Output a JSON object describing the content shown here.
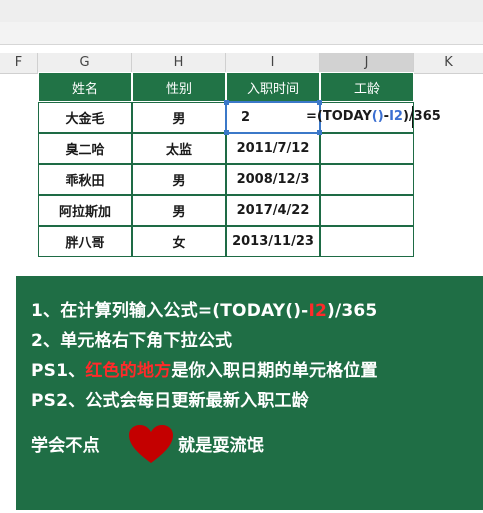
{
  "columns": [
    "F",
    "G",
    "H",
    "I",
    "J",
    "K"
  ],
  "table": {
    "headers": [
      "姓名",
      "性别",
      "入职时间",
      "工龄"
    ],
    "rows": [
      {
        "name": "大金毛",
        "gender": "男",
        "date": "2",
        "tenure": ""
      },
      {
        "name": "臭二哈",
        "gender": "太监",
        "date": "2011/7/12",
        "tenure": ""
      },
      {
        "name": "乖秋田",
        "gender": "男",
        "date": "2008/12/3",
        "tenure": ""
      },
      {
        "name": "阿拉斯加",
        "gender": "男",
        "date": "2017/4/22",
        "tenure": ""
      },
      {
        "name": "胖八哥",
        "gender": "女",
        "date": "2013/11/23",
        "tenure": ""
      }
    ]
  },
  "formula": {
    "prefix": "=(TODAY",
    "parens": "()",
    "minus": "-",
    "ref": "I2",
    "suffix": ")/365"
  },
  "tips": {
    "line1_prefix": "1、在计算列输入公式=(TODAY()-",
    "line1_ref": "I2",
    "line1_suffix": ")/365",
    "line2": "2、单元格右下角下拉公式",
    "line3_prefix": "PS1、",
    "line3_red": "红色的地方",
    "line3_suffix": "是你入职日期的单元格位置",
    "line4": "PS2、公式会每日更新最新入职工龄",
    "line5_before": "学会不点",
    "line5_after": "就是耍流氓"
  },
  "colors": {
    "header_green": "#217346",
    "panel_green": "#1f6e45",
    "accent_red": "#ff2a2a",
    "heart_red": "#c40000",
    "selection_blue": "#3b78c8"
  },
  "icons": [
    "heart-icon"
  ]
}
